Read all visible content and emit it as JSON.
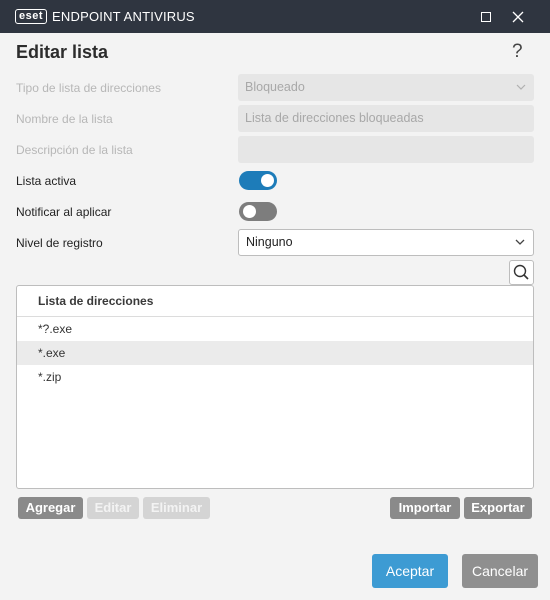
{
  "titlebar": {
    "brand": "eset",
    "product": "ENDPOINT ANTIVIRUS"
  },
  "page": {
    "title": "Editar lista",
    "help": "?"
  },
  "form": {
    "list_type": {
      "label": "Tipo de lista de direcciones",
      "value": "Bloqueado"
    },
    "list_name": {
      "label": "Nombre de la lista",
      "value": "Lista de direcciones bloqueadas"
    },
    "list_description": {
      "label": "Descripción de la lista",
      "value": ""
    },
    "active": {
      "label": "Lista activa",
      "state": "on"
    },
    "notify": {
      "label": "Notificar al aplicar",
      "state": "off"
    },
    "log_level": {
      "label": "Nivel de registro",
      "value": "Ninguno"
    }
  },
  "address_list": {
    "header": "Lista de direcciones",
    "items": [
      "*?.exe",
      "*.exe",
      "*.zip"
    ],
    "selected_index": 1
  },
  "list_buttons": {
    "add": "Agregar",
    "edit": "Editar",
    "delete": "Eliminar",
    "import": "Importar",
    "export": "Exportar"
  },
  "footer": {
    "accept": "Aceptar",
    "cancel": "Cancelar"
  },
  "colors": {
    "titlebar": "#2f3540",
    "accent": "#1d7cb9",
    "accept_button": "#3d9bd3"
  }
}
